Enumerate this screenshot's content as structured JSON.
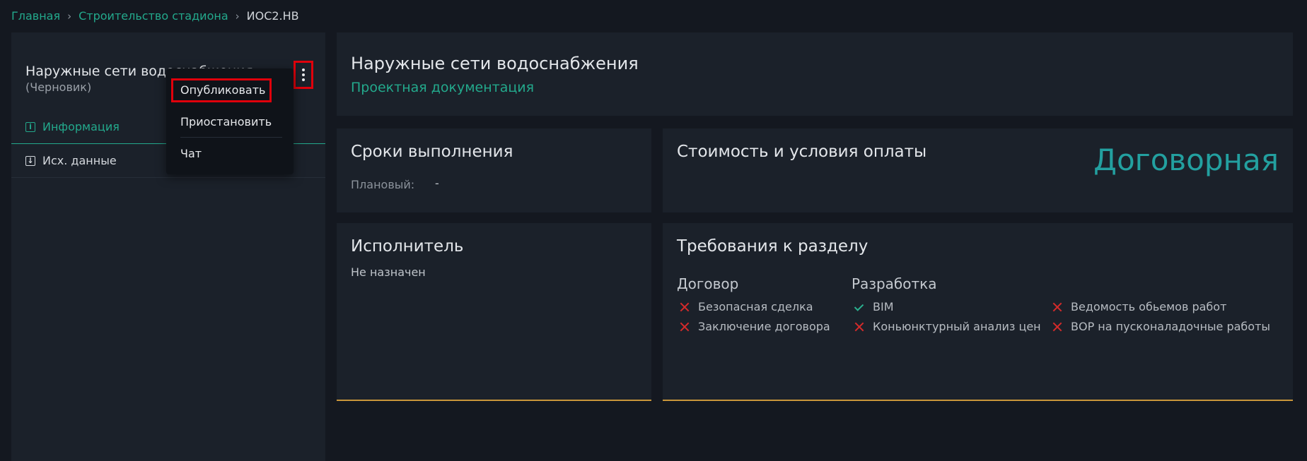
{
  "breadcrumb": {
    "home": "Главная",
    "project": "Строительство стадиона",
    "current": "ИОС2.НВ",
    "separator": "›"
  },
  "sidebar": {
    "title": "Наружные сети водоснабжения",
    "status": "(Черновик)",
    "items": [
      {
        "label": "Информация",
        "icon": "info-icon"
      },
      {
        "label": "Исх. данные",
        "icon": "download-icon"
      }
    ]
  },
  "menu": {
    "items": [
      "Опубликовать",
      "Приостановить",
      "Чат"
    ]
  },
  "header": {
    "title": "Наружные сети водоснабжения",
    "subtitle": "Проектная документация"
  },
  "deadline": {
    "title": "Сроки выполнения",
    "planned_label": "Плановый:",
    "planned_value": "-"
  },
  "cost": {
    "title": "Стоимость и условия оплаты",
    "price": "Договорная"
  },
  "executor": {
    "title": "Исполнитель",
    "value": "Не назначен"
  },
  "requirements": {
    "title": "Требования к разделу",
    "contract": {
      "heading": "Договор",
      "items": [
        {
          "label": "Безопасная сделка",
          "status": "x"
        },
        {
          "label": "Заключение договора",
          "status": "x"
        }
      ]
    },
    "development": {
      "heading": "Разработка",
      "items": [
        {
          "label": "BIM",
          "status": "check"
        },
        {
          "label": "Коньюнктурный анализ цен",
          "status": "x"
        },
        {
          "label": "Ведомость обьемов работ",
          "status": "x"
        },
        {
          "label": "ВОР на пусконаладочные работы",
          "status": "x"
        }
      ]
    }
  },
  "colors": {
    "accent": "#23a98c",
    "price": "#23a0a0",
    "error": "#d52b2b",
    "underline": "#c9963a",
    "highlight": "#e0000b"
  }
}
